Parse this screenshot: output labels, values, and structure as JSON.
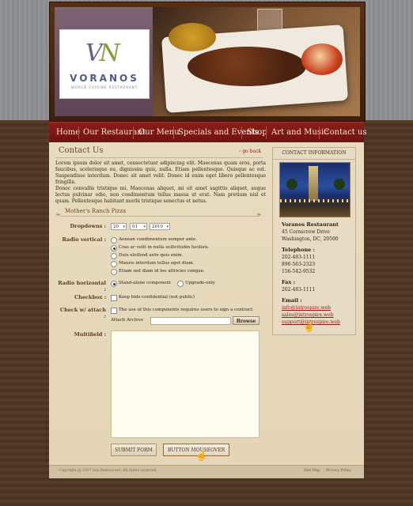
{
  "brand": {
    "monogram_v": "V",
    "monogram_n": "N",
    "name": "VORANOS",
    "tagline": "WORLD CUISINE RESTAURANT"
  },
  "nav": [
    "Home",
    "Our Restaurant",
    "Our Menu",
    "Specials and Events",
    "Shop",
    "Art and Music",
    "Contact us"
  ],
  "page": {
    "title": "Contact Us",
    "go_back": "go back",
    "paragraph1": "Lorem ipsum dolor sit amet, consectetuer adipiscing elit. Maecenas quam eros, porta faucibus, scelerisque eu, dignissim quis, nulla. Etiam pellentesque. Quisque ac est. Suspendisse interdum. Donec sit amet velit. Donec id enim eget libero pellentesque fringilla.",
    "paragraph2": "Donec convallis tristique mi. Maecenas aliquet, mi sit amet sagittis aliquet, augue lectus pulvinar odio, non condimentum tellus massa ut erat. Nam pretium nisl et quam. Pellentesque habitant morbi tristique senectus et netus.",
    "section_title": "Mother's Ranch Pizza"
  },
  "form": {
    "dropdowns_label": "Dropdowns :",
    "dropdowns": [
      "20",
      "01",
      "2010"
    ],
    "radio_vertical_label": "Radio vertical :",
    "radio_vertical_options": [
      "Aenean condimentum semper ante.",
      "Cras ac velit in nulla sollicitudin facilisis.",
      "Duis eleifend ante quis enim.",
      "Mauris interdum tellus eget diam.",
      "Etiam sed diam id leo ultricies congue."
    ],
    "radio_vertical_selected": 1,
    "radio_horizontal_label": "Radio horizontal :",
    "radio_horizontal_options": [
      "Stand-alone component",
      "Upgrade-only"
    ],
    "radio_horizontal_selected": 0,
    "checkbox_label": "Checkbox :",
    "checkbox_text": "Keep bids confidential (not public)",
    "check_attach_label": "Check w/ attach :",
    "check_attach_text": "The use of this components requires users to sign a contract",
    "attach_label": "Attach Archive",
    "attach_value": "",
    "browse_label": "Browse",
    "multifield_label": "Multifield :",
    "multifield_value": "",
    "submit_label": "SUBMIT FORM",
    "hover_button_label": "BUTTON MOUSEOVER"
  },
  "sidebar": {
    "title": "CONTACT INFORMATION",
    "name": "Voranos Restaurant",
    "address1": "45 Cornscrew Drive",
    "address2": "Washington, DC, 20500",
    "telephone_label": "Telephone :",
    "phones": [
      "202-483-1111",
      "896-563-2323",
      "156-542-9532"
    ],
    "fax_label": "Fax :",
    "fax": "202-483-1111",
    "email_label": "Email :",
    "emails": [
      "info@introspire.web",
      "sales@introspire.web",
      "support@introspire.web"
    ]
  },
  "footer": {
    "copyright": "Copyright @ 2007 Inis Restaurant, All rights reserved.",
    "links": [
      "Site Map",
      "Privacy Policy"
    ]
  },
  "colors": {
    "nav_bg": "#7a1a16",
    "link": "#8b1a14",
    "page_bg": "#e6d9bb",
    "heading": "#6e4a2a"
  }
}
